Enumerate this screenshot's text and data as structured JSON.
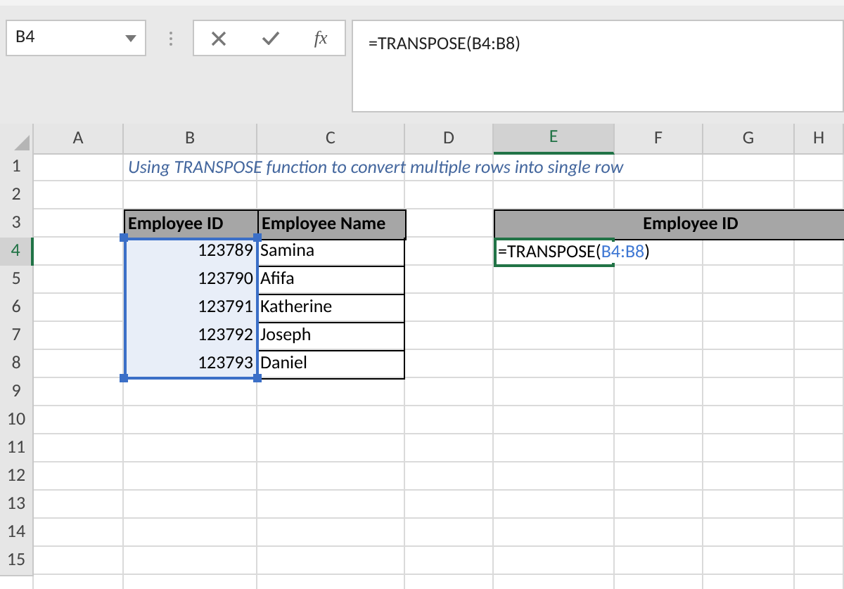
{
  "name_box": {
    "value": "B4"
  },
  "formula_bar": {
    "fx_label": "fx",
    "value": "=TRANSPOSE(B4:B8)"
  },
  "columns": [
    {
      "label": "A",
      "selected": false
    },
    {
      "label": "B",
      "selected": false
    },
    {
      "label": "C",
      "selected": false
    },
    {
      "label": "D",
      "selected": false
    },
    {
      "label": "E",
      "selected": true
    },
    {
      "label": "F",
      "selected": false
    },
    {
      "label": "G",
      "selected": false
    },
    {
      "label": "H",
      "selected": false
    }
  ],
  "rows": [
    {
      "label": "1",
      "selected": false
    },
    {
      "label": "2",
      "selected": false
    },
    {
      "label": "3",
      "selected": false
    },
    {
      "label": "4",
      "selected": true
    },
    {
      "label": "5",
      "selected": false
    },
    {
      "label": "6",
      "selected": false
    },
    {
      "label": "7",
      "selected": false
    },
    {
      "label": "8",
      "selected": false
    },
    {
      "label": "9",
      "selected": false
    },
    {
      "label": "10",
      "selected": false
    },
    {
      "label": "11",
      "selected": false
    },
    {
      "label": "12",
      "selected": false
    },
    {
      "label": "13",
      "selected": false
    },
    {
      "label": "14",
      "selected": false
    },
    {
      "label": "15",
      "selected": false
    }
  ],
  "title": "Using TRANSPOSE function to convert multiple rows into single row",
  "table": {
    "columns": [
      "Employee ID",
      "Employee Name"
    ],
    "rows": [
      {
        "id": "123789",
        "name": "Samina",
        "selected": true
      },
      {
        "id": "123790",
        "name": "Afifa",
        "selected": true
      },
      {
        "id": "123791",
        "name": "Katherine",
        "selected": true
      },
      {
        "id": "123792",
        "name": "Joseph",
        "selected": true
      },
      {
        "id": "123793",
        "name": "Daniel",
        "selected": true
      }
    ]
  },
  "output": {
    "header": "Employee ID",
    "editing": true,
    "formula": [
      {
        "kind": "text",
        "text": "=TRANSPOSE("
      },
      {
        "kind": "reference",
        "text": "B4:B8"
      },
      {
        "kind": "text",
        "text": ")"
      }
    ]
  }
}
